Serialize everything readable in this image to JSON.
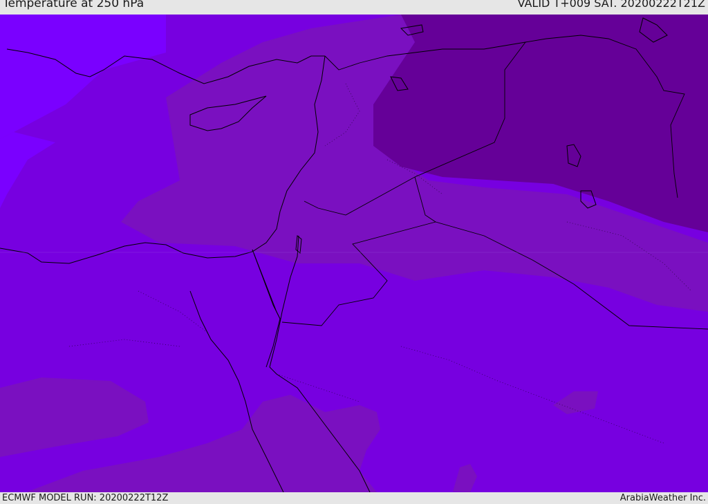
{
  "header": {
    "title": "Temperature at 250 hPa",
    "valid": "VALID T+009 SAT. 20200222T21Z"
  },
  "footer": {
    "model_run": "ECMWF MODEL RUN: 20200222T12Z",
    "credit": "ArabiaWeather Inc."
  },
  "colors": {
    "warmest": "#7a00ff",
    "warm": "#7700e8",
    "mid": "#7a0fc0",
    "cool": "#6a009f",
    "coastline": "#000000"
  }
}
